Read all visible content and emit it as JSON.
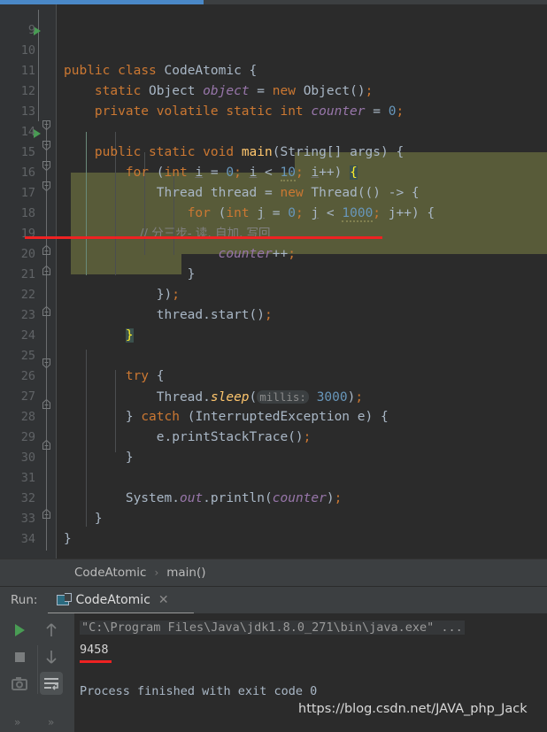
{
  "window": {
    "theme_bg": "#2b2b2b",
    "gutter_bg": "#313335",
    "accent_blue": "#4a88c7",
    "highlight_olive": "#585b39",
    "annotation_red": "#ee2222"
  },
  "editor": {
    "first_visible_line": 9,
    "lines": [
      {
        "num": "9",
        "text": ""
      },
      {
        "num": "10",
        "text": "public class CodeAtomic {"
      },
      {
        "num": "11",
        "text": "    static Object object = new Object();"
      },
      {
        "num": "12",
        "text": "    private volatile static int counter = 0;"
      },
      {
        "num": "13",
        "text": ""
      },
      {
        "num": "14",
        "text": "    public static void main(String[] args) {"
      },
      {
        "num": "15",
        "text": "        for (int i = 0; i < 10; i++) {"
      },
      {
        "num": "16",
        "text": "            Thread thread = new Thread(() -> {"
      },
      {
        "num": "17",
        "text": "                for (int j = 0; j < 1000; j++) {"
      },
      {
        "num": "18",
        "text": "                    // 分三步- 读, 自加, 写回"
      },
      {
        "num": "19",
        "text": "                    counter++;"
      },
      {
        "num": "20",
        "text": "                }"
      },
      {
        "num": "21",
        "text": "            });"
      },
      {
        "num": "22",
        "text": "            thread.start();"
      },
      {
        "num": "23",
        "text": "        }"
      },
      {
        "num": "24",
        "text": ""
      },
      {
        "num": "25",
        "text": "        try {"
      },
      {
        "num": "26",
        "text": "            Thread.sleep( millis: 3000);"
      },
      {
        "num": "27",
        "text": "        } catch (InterruptedException e) {"
      },
      {
        "num": "28",
        "text": "            e.printStackTrace();"
      },
      {
        "num": "29",
        "text": "        }"
      },
      {
        "num": "30",
        "text": ""
      },
      {
        "num": "31",
        "text": "        System.out.println(counter);"
      },
      {
        "num": "32",
        "text": "    }"
      },
      {
        "num": "33",
        "text": "}"
      },
      {
        "num": "34",
        "text": ""
      }
    ],
    "tokens": {
      "kw_public": "public",
      "kw_class": "class",
      "class_name": "CodeAtomic",
      "kw_static": "static",
      "type_object": "Object",
      "var_object": "object",
      "kw_new": "new",
      "kw_private": "private",
      "kw_volatile": "volatile",
      "kw_int": "int",
      "var_counter": "counter",
      "kw_void": "void",
      "method_main": "main",
      "type_string": "String",
      "var_args": "args",
      "kw_for": "for",
      "var_i": "i",
      "num_10": "10",
      "type_thread": "Thread",
      "var_thread": "thread",
      "var_j": "j",
      "num_1000": "1000",
      "comment_cn": "// 分三步- 读, 自加, 写回",
      "kw_try": "try",
      "method_sleep": "sleep",
      "hint_millis": "millis:",
      "num_3000": "3000",
      "kw_catch": "catch",
      "type_ie": "InterruptedException",
      "var_e": "e",
      "method_pst": "printStackTrace",
      "cls_system": "System",
      "field_out": "out",
      "method_println": "println"
    }
  },
  "breadcrumb": {
    "items": [
      "CodeAtomic",
      "main()"
    ],
    "separator": "›"
  },
  "run_window": {
    "label": "Run:",
    "tab_name": "CodeAtomic",
    "tab_close": "✕",
    "sidebar_buttons": [
      {
        "name": "rerun-button",
        "glyph": "▶"
      },
      {
        "name": "stop-button",
        "glyph": "■"
      },
      {
        "name": "screenshot-button",
        "glyph": "▣"
      },
      {
        "name": "scroll-up-button",
        "glyph": "↑"
      },
      {
        "name": "scroll-down-button",
        "glyph": "↓"
      },
      {
        "name": "soft-wrap-button",
        "glyph": "⇥"
      }
    ],
    "expand_chevron": "»",
    "console": {
      "command_line": "\"C:\\Program Files\\Java\\jdk1.8.0_271\\bin\\java.exe\" ...",
      "output_value": "9458",
      "exit_line": "Process finished with exit code 0"
    }
  },
  "watermark": "https://blog.csdn.net/JAVA_php_Jack"
}
